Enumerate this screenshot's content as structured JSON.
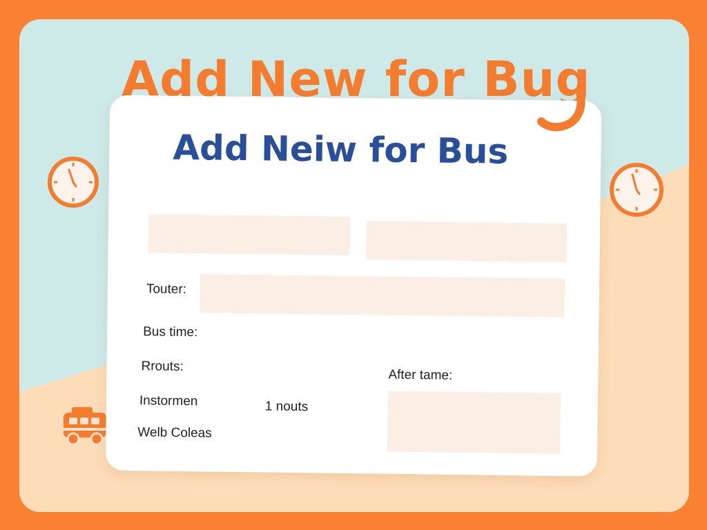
{
  "header": {
    "title": "Add New for Bug"
  },
  "form": {
    "title": "Add Neiw for Bus",
    "labels": {
      "touter": "Touter:",
      "bus_time": "Bus time:",
      "routes": "Rrouts:",
      "after_time": "After tame:",
      "instrument": "Instormen",
      "nouts": "1 nouts",
      "web_colors": "Welb Coleas"
    }
  },
  "icons": [
    "clock-icon",
    "clock-icon",
    "bus-icon"
  ],
  "colors": {
    "frame": "#fa8132",
    "sky": "#cde9e8",
    "sand": "#fddcb7",
    "accent_orange": "#f47c2f",
    "title_blue": "#2a4f9a",
    "field_fill": "#fbeee4",
    "card": "#ffffff"
  }
}
